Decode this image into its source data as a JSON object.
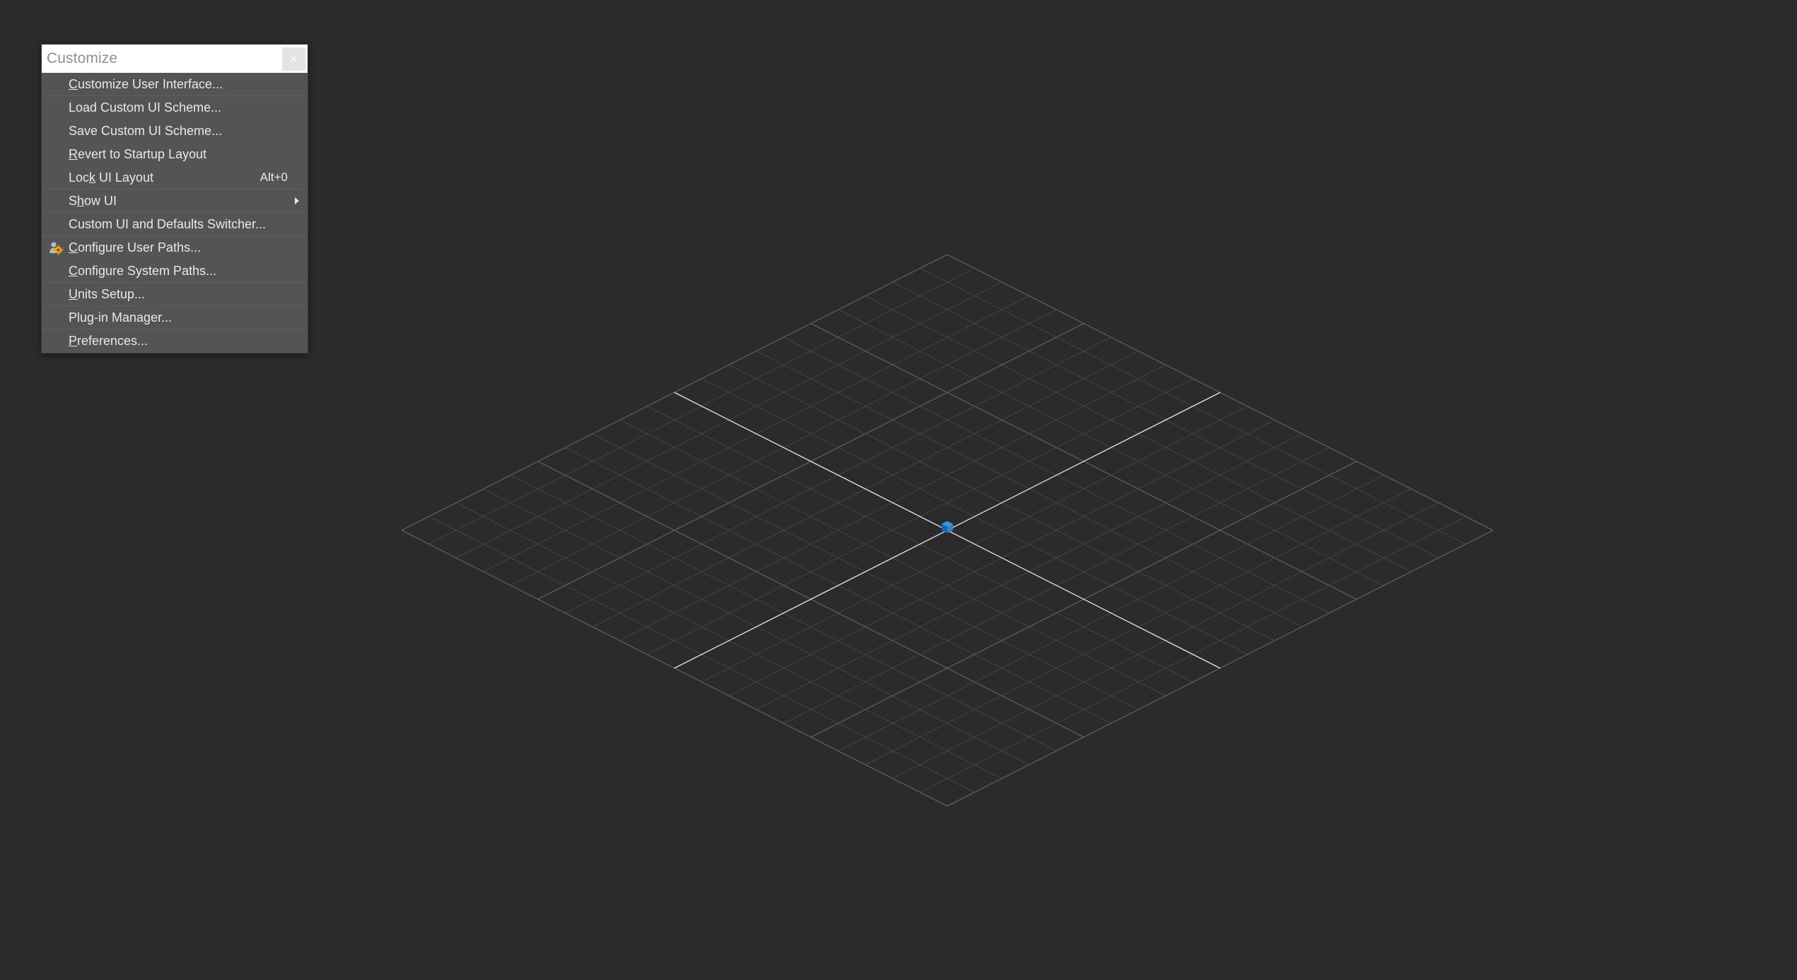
{
  "viewport": {
    "background_color": "#2b2b2b",
    "grid_minor_color": "#4a4a4a",
    "grid_major_color": "#6e6e6e",
    "axis_line_color": "#f2f2f2",
    "origin_object_color": "#1f76c8",
    "origin_object_name": "box-at-origin",
    "grid_divisions": 20
  },
  "panel": {
    "title": "Customize",
    "close_label": "×",
    "items": [
      {
        "id": "customize-user-interface",
        "label": "Customize User Interface...",
        "mnemonic": "C",
        "shortcut": "",
        "submenu": false,
        "icon": "",
        "separator_below": true
      },
      {
        "id": "load-custom-ui-scheme",
        "label": "Load Custom UI Scheme...",
        "mnemonic": "",
        "shortcut": "",
        "submenu": false,
        "icon": "",
        "separator_below": false
      },
      {
        "id": "save-custom-ui-scheme",
        "label": "Save Custom UI Scheme...",
        "mnemonic": "",
        "shortcut": "",
        "submenu": false,
        "icon": "",
        "separator_below": false
      },
      {
        "id": "revert-to-startup-layout",
        "label": "Revert to Startup Layout",
        "mnemonic": "R",
        "shortcut": "",
        "submenu": false,
        "icon": "",
        "separator_below": false
      },
      {
        "id": "lock-ui-layout",
        "label": "Lock UI Layout",
        "mnemonic": "k",
        "shortcut": "Alt+0",
        "submenu": false,
        "icon": "",
        "separator_below": true
      },
      {
        "id": "show-ui",
        "label": "Show UI",
        "mnemonic": "h",
        "shortcut": "",
        "submenu": true,
        "icon": "",
        "separator_below": true
      },
      {
        "id": "custom-ui-and-defaults-switcher",
        "label": "Custom UI and Defaults Switcher...",
        "mnemonic": "",
        "shortcut": "",
        "submenu": false,
        "icon": "",
        "separator_below": true
      },
      {
        "id": "configure-user-paths",
        "label": "Configure User Paths...",
        "mnemonic": "C",
        "shortcut": "",
        "submenu": false,
        "icon": "user-gear-icon",
        "separator_below": false
      },
      {
        "id": "configure-system-paths",
        "label": "Configure System Paths...",
        "mnemonic": "C",
        "shortcut": "",
        "submenu": false,
        "icon": "",
        "separator_below": true
      },
      {
        "id": "units-setup",
        "label": "Units Setup...",
        "mnemonic": "U",
        "shortcut": "",
        "submenu": false,
        "icon": "",
        "separator_below": true
      },
      {
        "id": "plug-in-manager",
        "label": "Plug-in Manager...",
        "mnemonic": "",
        "shortcut": "",
        "submenu": false,
        "icon": "",
        "separator_below": true
      },
      {
        "id": "preferences",
        "label": "Preferences...",
        "mnemonic": "P",
        "shortcut": "",
        "submenu": false,
        "icon": "",
        "separator_below": false
      }
    ]
  }
}
